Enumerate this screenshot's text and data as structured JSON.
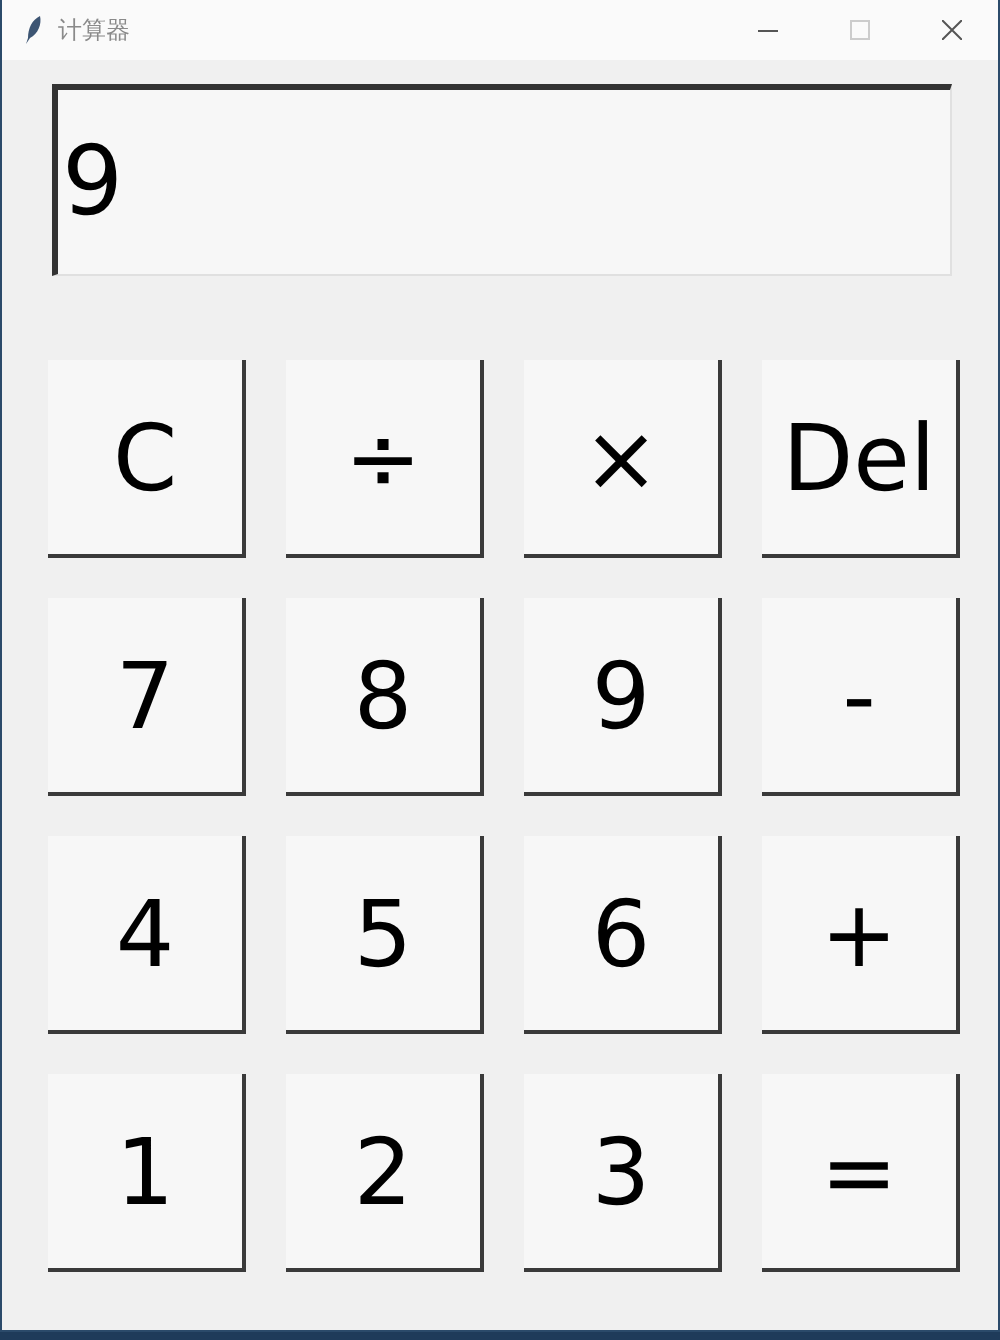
{
  "window": {
    "title": "计算器"
  },
  "display": {
    "value": "9"
  },
  "keys": [
    {
      "label": "C"
    },
    {
      "label": "÷"
    },
    {
      "label": "×"
    },
    {
      "label": "Del"
    },
    {
      "label": "7"
    },
    {
      "label": "8"
    },
    {
      "label": "9"
    },
    {
      "label": "-"
    },
    {
      "label": "4"
    },
    {
      "label": "5"
    },
    {
      "label": "6"
    },
    {
      "label": "+"
    },
    {
      "label": "1"
    },
    {
      "label": "2"
    },
    {
      "label": "3"
    },
    {
      "label": "="
    }
  ]
}
